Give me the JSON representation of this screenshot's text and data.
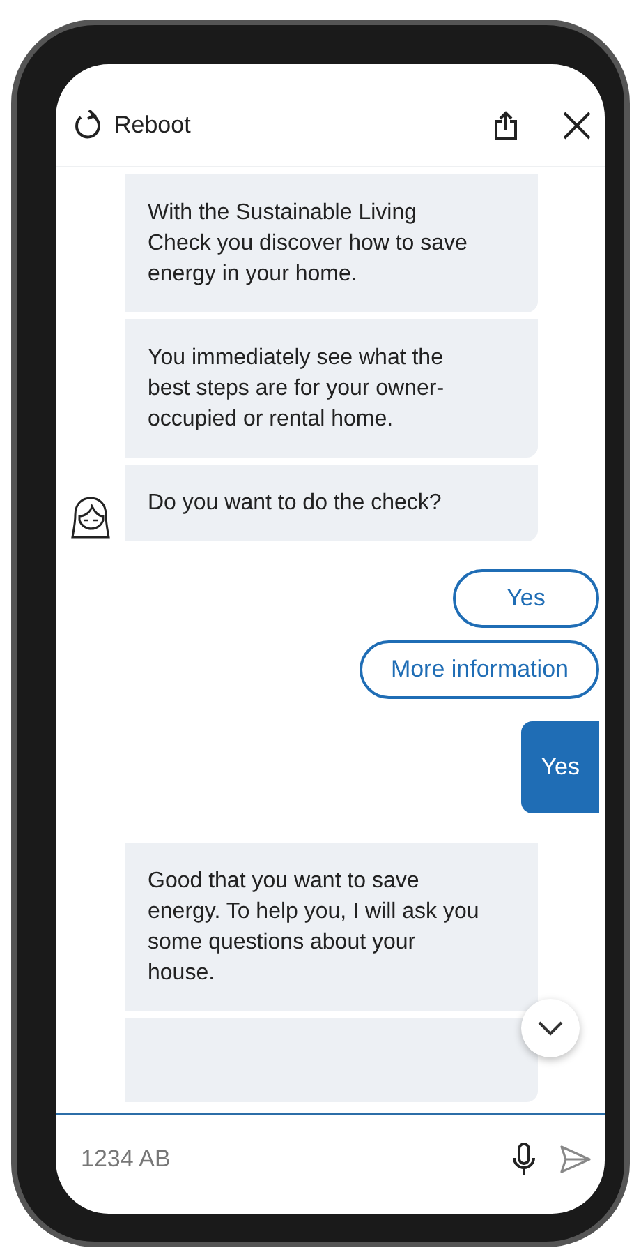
{
  "header": {
    "reboot_label": "Reboot"
  },
  "messages": [
    {
      "kind": "bot",
      "text": "With the Sustainable Living Check you discover how to save energy in your home.",
      "avatar": false
    },
    {
      "kind": "bot",
      "text": "You immediately see what the best steps are for your owner-occupied or rental home.",
      "avatar": false
    },
    {
      "kind": "bot",
      "text": "Do you want to do the check?",
      "avatar": true
    },
    {
      "kind": "options",
      "options": [
        "Yes",
        "More information"
      ]
    },
    {
      "kind": "user",
      "text": "Yes"
    },
    {
      "kind": "bot",
      "text": "Good that you want to save energy. To help you, I will ask you some questions about your house.",
      "avatar": false
    },
    {
      "kind": "bot-cut"
    }
  ],
  "input": {
    "placeholder": "1234 AB"
  }
}
